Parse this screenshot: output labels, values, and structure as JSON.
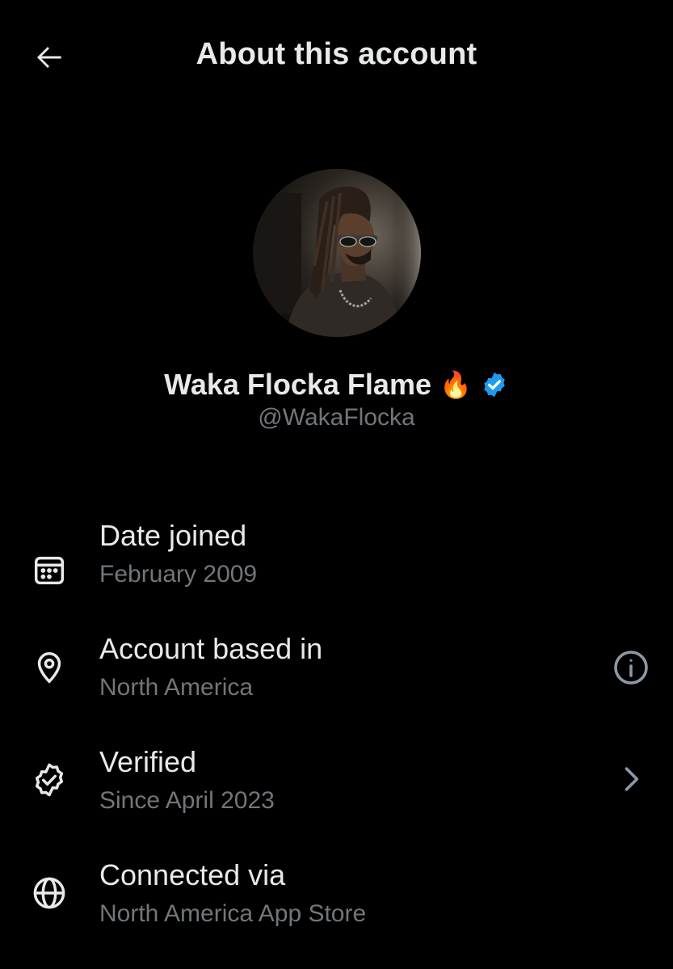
{
  "header": {
    "title": "About this account",
    "back_icon": "arrow-left-icon"
  },
  "profile": {
    "display_name": "Waka Flocka Flame",
    "name_emoji": "🔥",
    "verified_badge_color": "#1d9bf0",
    "handle": "@WakaFlocka"
  },
  "details": [
    {
      "icon": "calendar-icon",
      "title": "Date joined",
      "value": "February 2009"
    },
    {
      "icon": "location-pin-icon",
      "title": "Account based in",
      "value": "North America",
      "trailing_icon": "info-icon"
    },
    {
      "icon": "verified-badge-outline-icon",
      "title": "Verified",
      "value": "Since April 2023",
      "trailing_icon": "chevron-right-icon"
    },
    {
      "icon": "globe-icon",
      "title": "Connected via",
      "value": "North America App Store"
    }
  ],
  "colors": {
    "background": "#000000",
    "primary_text": "#e7e9ea",
    "secondary_text": "#71767b",
    "accent_blue": "#1d9bf0"
  }
}
